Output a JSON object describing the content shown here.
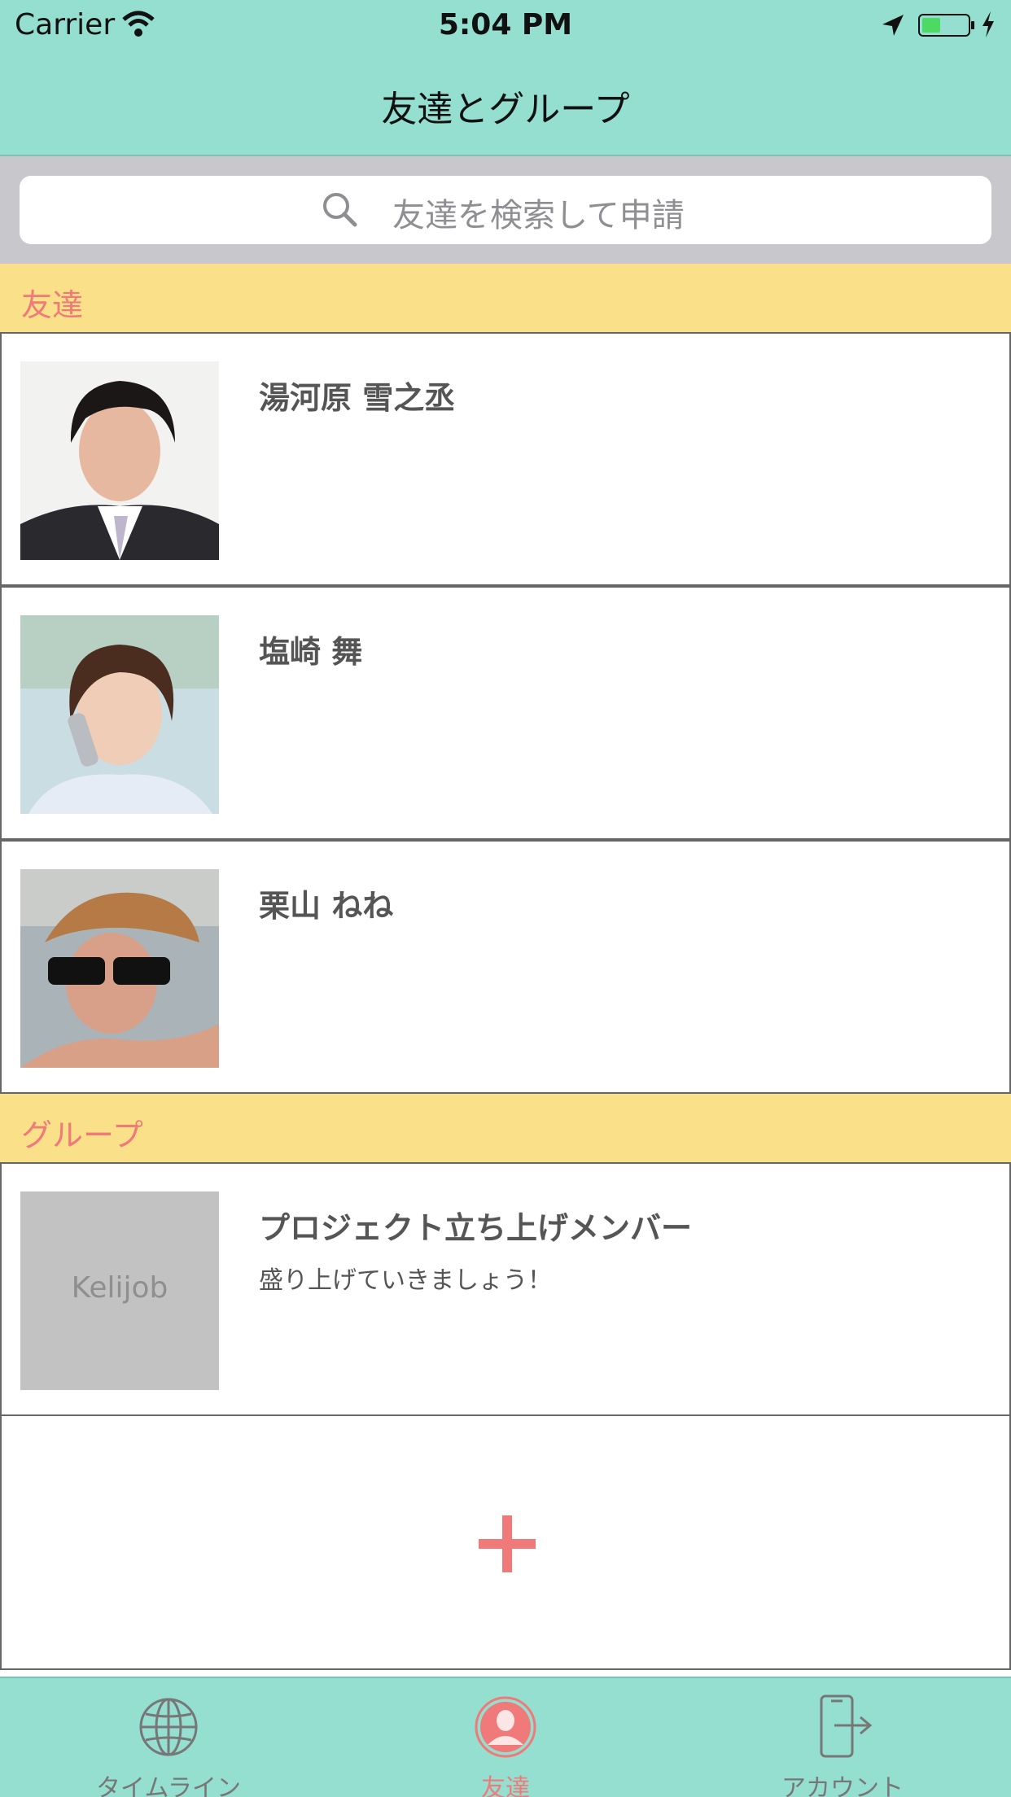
{
  "status_bar": {
    "carrier": "Carrier",
    "time": "5:04 PM",
    "battery_color": "#4cd964"
  },
  "nav": {
    "title": "友達とグループ"
  },
  "search": {
    "placeholder": "友達を検索して申請"
  },
  "sections": {
    "friends": "友達",
    "groups": "グループ"
  },
  "friends": [
    {
      "name": "湯河原 雪之丞"
    },
    {
      "name": "塩崎 舞"
    },
    {
      "name": "栗山 ねね"
    }
  ],
  "groups": [
    {
      "name": "プロジェクト立ち上げメンバー",
      "subtitle": "盛り上げていきましょう！",
      "placeholder_text": "Kelijob"
    }
  ],
  "tabs": [
    {
      "label": "タイムライン",
      "icon": "globe-icon",
      "active": false
    },
    {
      "label": "友達",
      "icon": "person-icon",
      "active": true
    },
    {
      "label": "アカウント",
      "icon": "logout-icon",
      "active": false
    }
  ],
  "colors": {
    "accent": "#f07a7a",
    "bar": "#94dfcf",
    "section": "#fbe08a"
  }
}
